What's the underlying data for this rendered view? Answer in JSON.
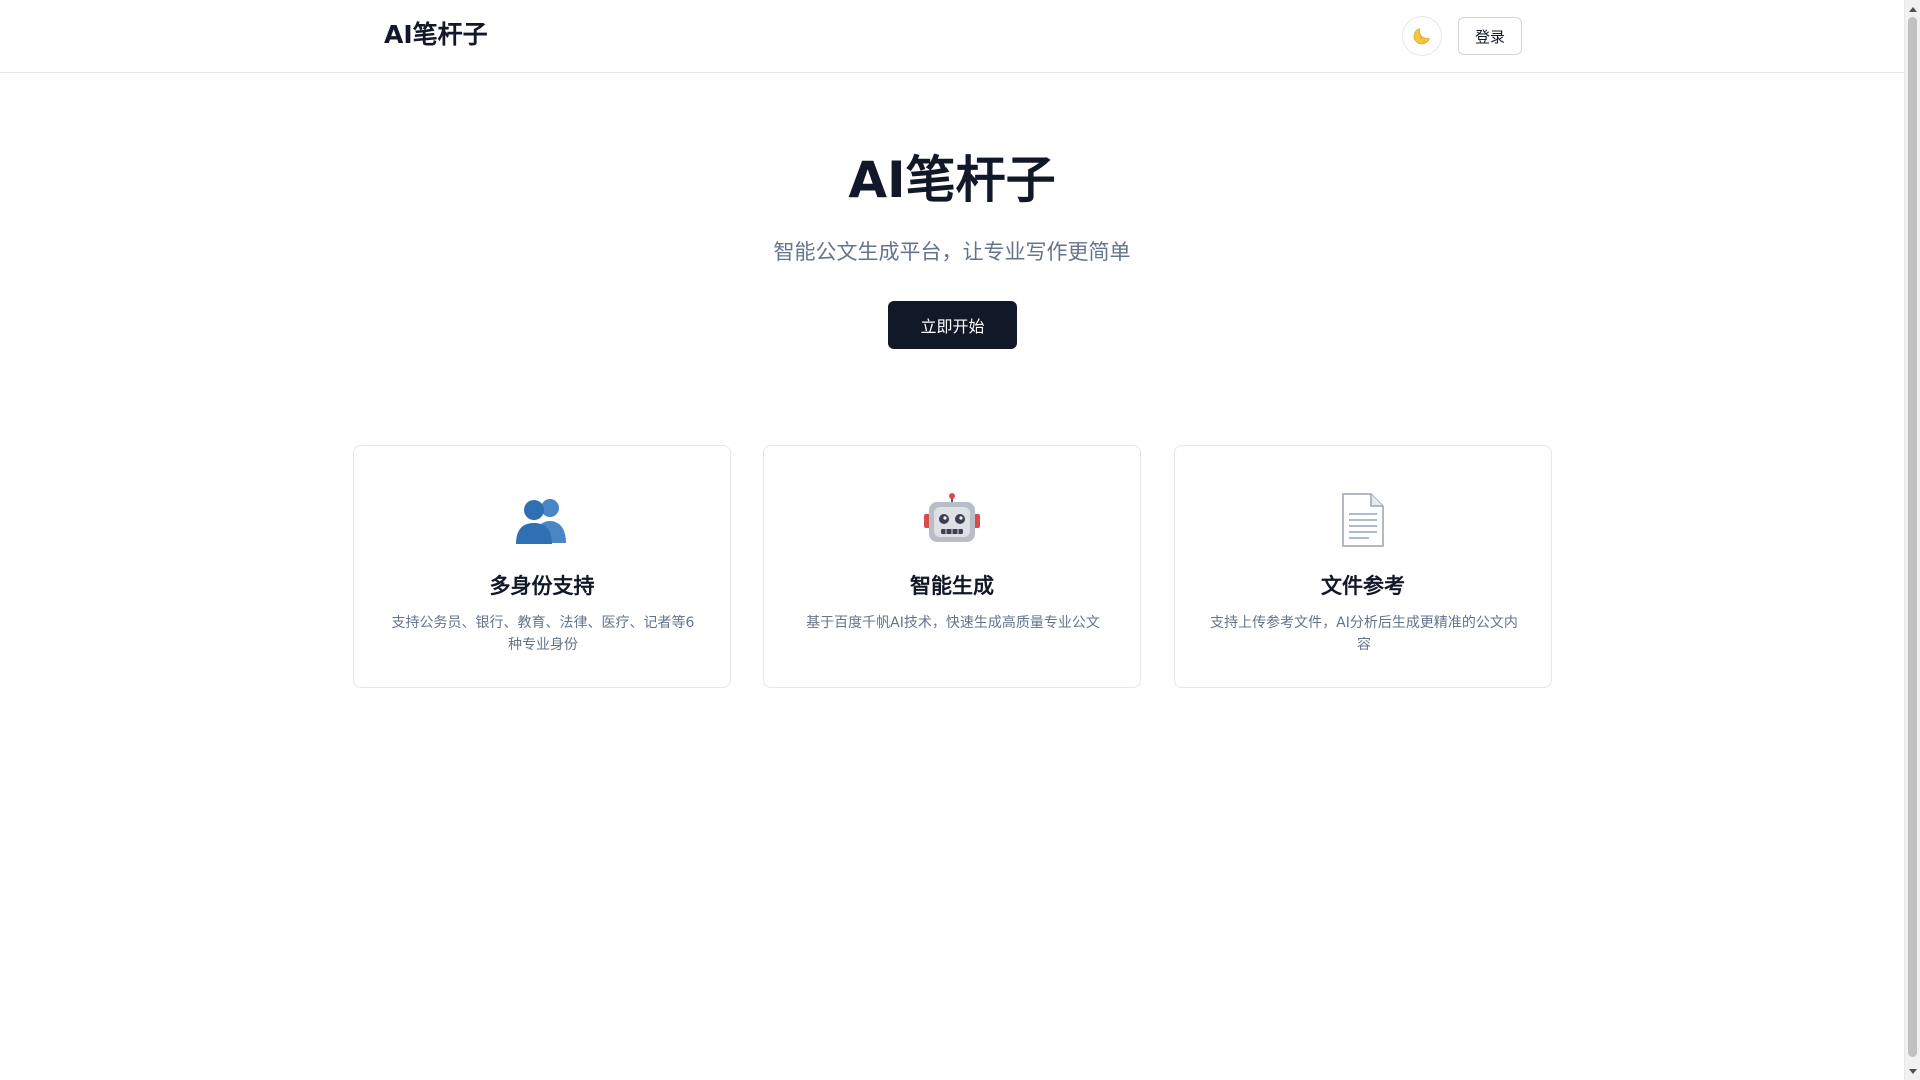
{
  "header": {
    "brand": "AI笔杆子",
    "theme_icon": "moon-icon",
    "login_label": "登录"
  },
  "hero": {
    "title": "AI笔杆子",
    "subtitle": "智能公文生成平台，让专业写作更简单",
    "cta_label": "立即开始"
  },
  "features": [
    {
      "icon": "people-icon",
      "title": "多身份支持",
      "description": "支持公务员、银行、教育、法律、医疗、记者等6种专业身份"
    },
    {
      "icon": "robot-icon",
      "title": "智能生成",
      "description": "基于百度千帆AI技术，快速生成高质量专业公文"
    },
    {
      "icon": "document-icon",
      "title": "文件参考",
      "description": "支持上传参考文件，AI分析后生成更精准的公文内容"
    }
  ],
  "colors": {
    "primary": "#111827",
    "muted_text": "#64748b",
    "border": "#e5e7eb",
    "icon_blue": "#2f6fb3",
    "robot_red": "#d94b4b"
  }
}
